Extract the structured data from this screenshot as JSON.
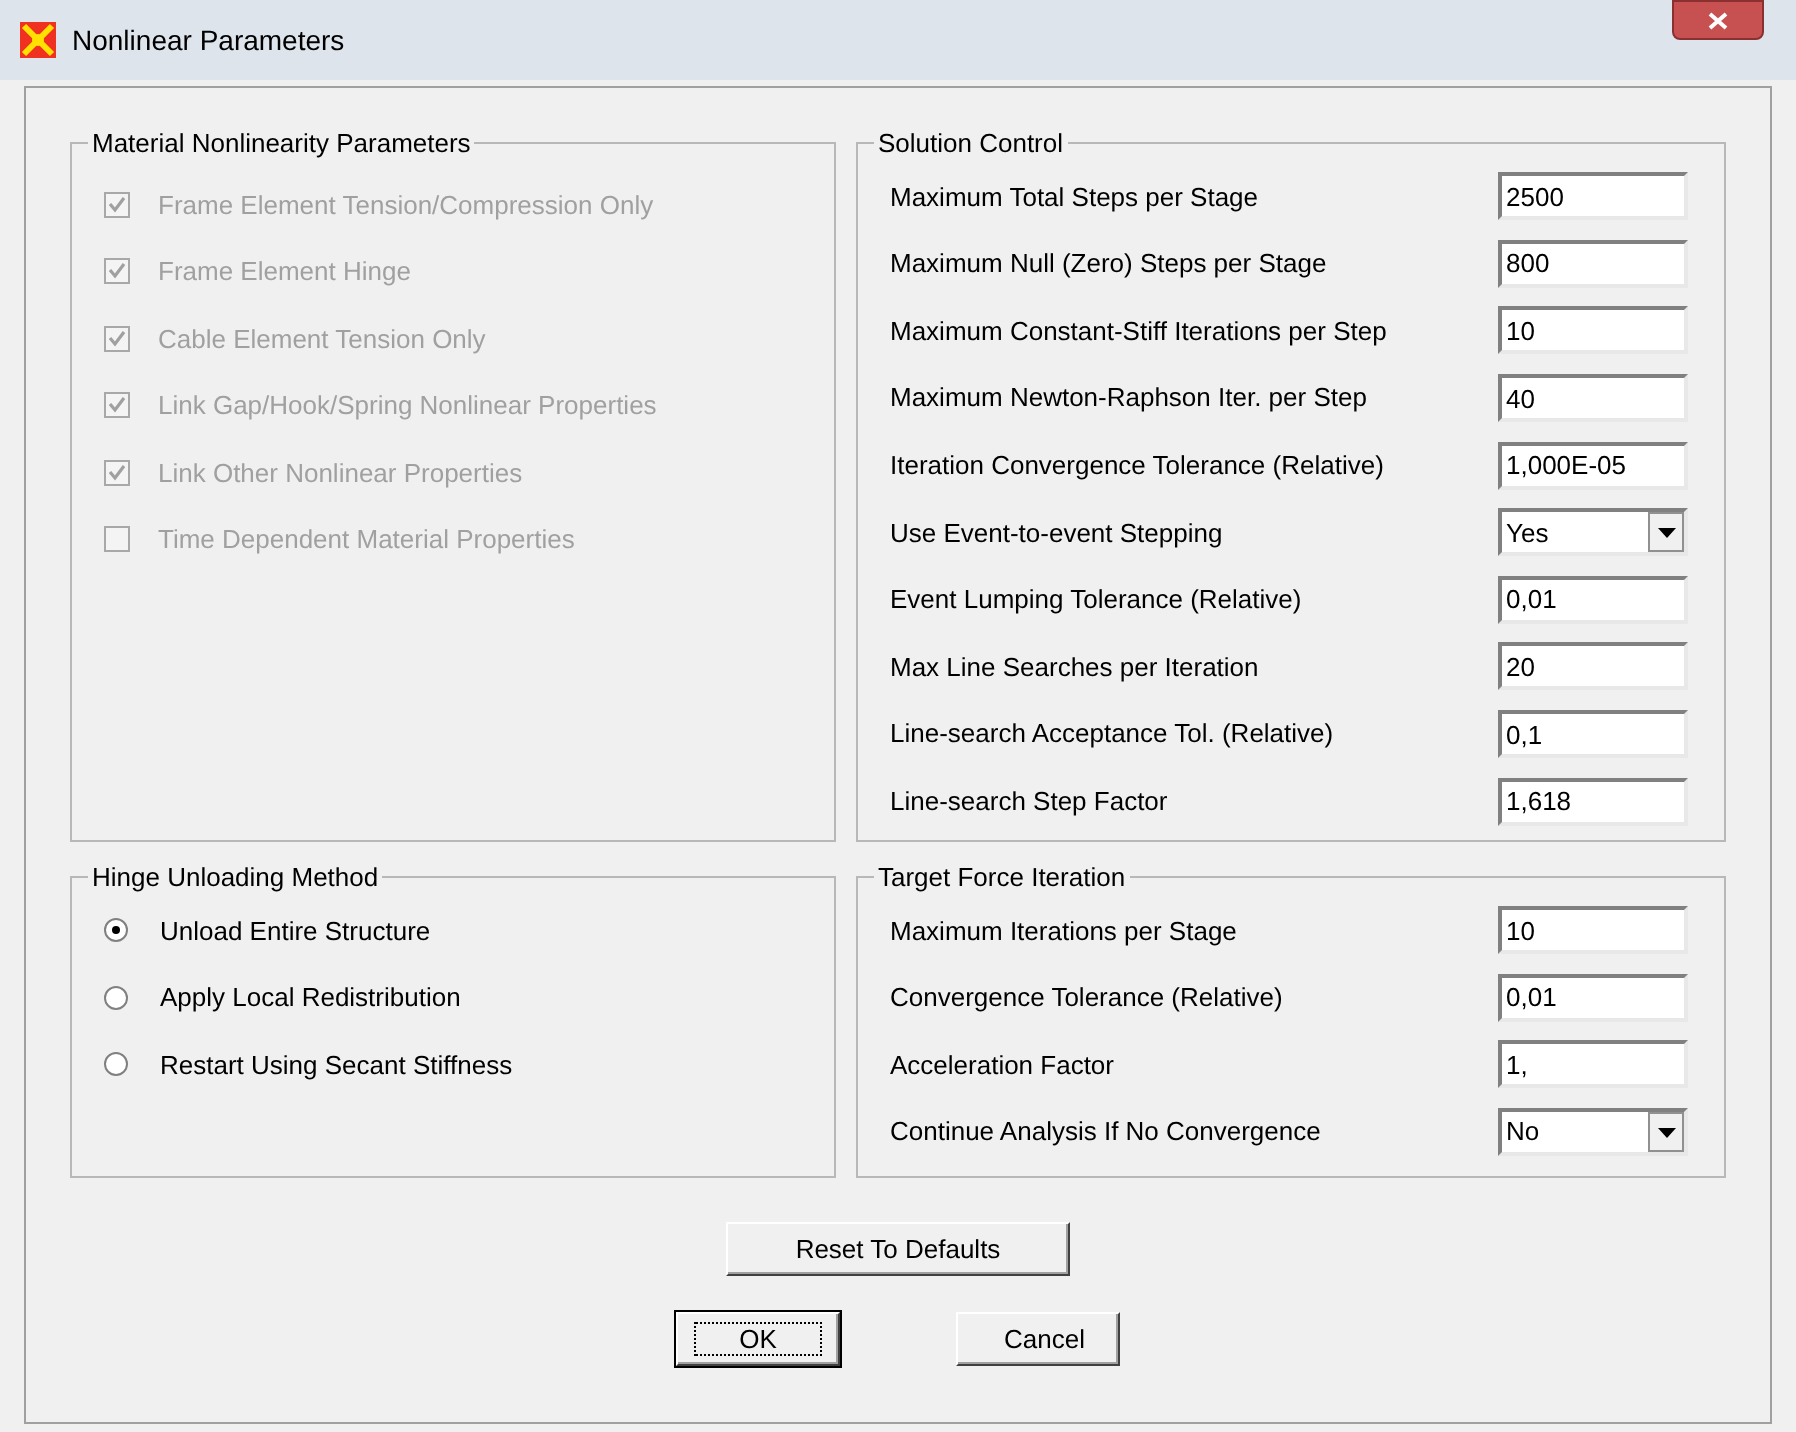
{
  "window": {
    "title": "Nonlinear Parameters"
  },
  "material_nonlinearity": {
    "title": "Material Nonlinearity Parameters",
    "options": [
      {
        "label": "Frame Element Tension/Compression Only",
        "checked": true,
        "disabled": true
      },
      {
        "label": "Frame Element Hinge",
        "checked": true,
        "disabled": true
      },
      {
        "label": "Cable Element Tension Only",
        "checked": true,
        "disabled": true
      },
      {
        "label": "Link Gap/Hook/Spring Nonlinear Properties",
        "checked": true,
        "disabled": true
      },
      {
        "label": "Link Other Nonlinear Properties",
        "checked": true,
        "disabled": true
      },
      {
        "label": "Time Dependent Material Properties",
        "checked": false,
        "disabled": true
      }
    ]
  },
  "solution_control": {
    "title": "Solution Control",
    "fields": [
      {
        "label": "Maximum Total Steps per Stage",
        "kind": "text",
        "value": "2500"
      },
      {
        "label": "Maximum Null (Zero) Steps per Stage",
        "kind": "text",
        "value": "800"
      },
      {
        "label": "Maximum Constant-Stiff Iterations per Step",
        "kind": "text",
        "value": "10"
      },
      {
        "label": "Maximum Newton-Raphson Iter. per Step",
        "kind": "text",
        "value": "40"
      },
      {
        "label": "Iteration Convergence Tolerance (Relative)",
        "kind": "text",
        "value": "1,000E-05"
      },
      {
        "label": "Use Event-to-event Stepping",
        "kind": "dropdown",
        "value": "Yes"
      },
      {
        "label": "Event Lumping Tolerance (Relative)",
        "kind": "text",
        "value": "0,01"
      },
      {
        "label": "Max Line Searches per Iteration",
        "kind": "text",
        "value": "20"
      },
      {
        "label": "Line-search Acceptance Tol. (Relative)",
        "kind": "text",
        "value": "0,1"
      },
      {
        "label": "Line-search Step Factor",
        "kind": "text",
        "value": "1,618"
      }
    ]
  },
  "hinge_unloading": {
    "title": "Hinge Unloading Method",
    "options": [
      {
        "label": "Unload Entire Structure",
        "selected": true
      },
      {
        "label": "Apply Local Redistribution",
        "selected": false
      },
      {
        "label": "Restart Using Secant Stiffness",
        "selected": false
      }
    ]
  },
  "target_force_iteration": {
    "title": "Target Force Iteration",
    "fields": [
      {
        "label": "Maximum Iterations per Stage",
        "kind": "text",
        "value": "10"
      },
      {
        "label": "Convergence Tolerance (Relative)",
        "kind": "text",
        "value": "0,01"
      },
      {
        "label": "Acceleration Factor",
        "kind": "text",
        "value": "1,"
      },
      {
        "label": "Continue Analysis If No Convergence",
        "kind": "dropdown",
        "value": "No"
      }
    ]
  },
  "buttons": [
    {
      "label": "Reset To Defaults",
      "kind": "reset"
    },
    {
      "label": "OK",
      "kind": "ok",
      "focused": true
    },
    {
      "label": "Cancel",
      "kind": "cancel",
      "focused": false
    }
  ]
}
